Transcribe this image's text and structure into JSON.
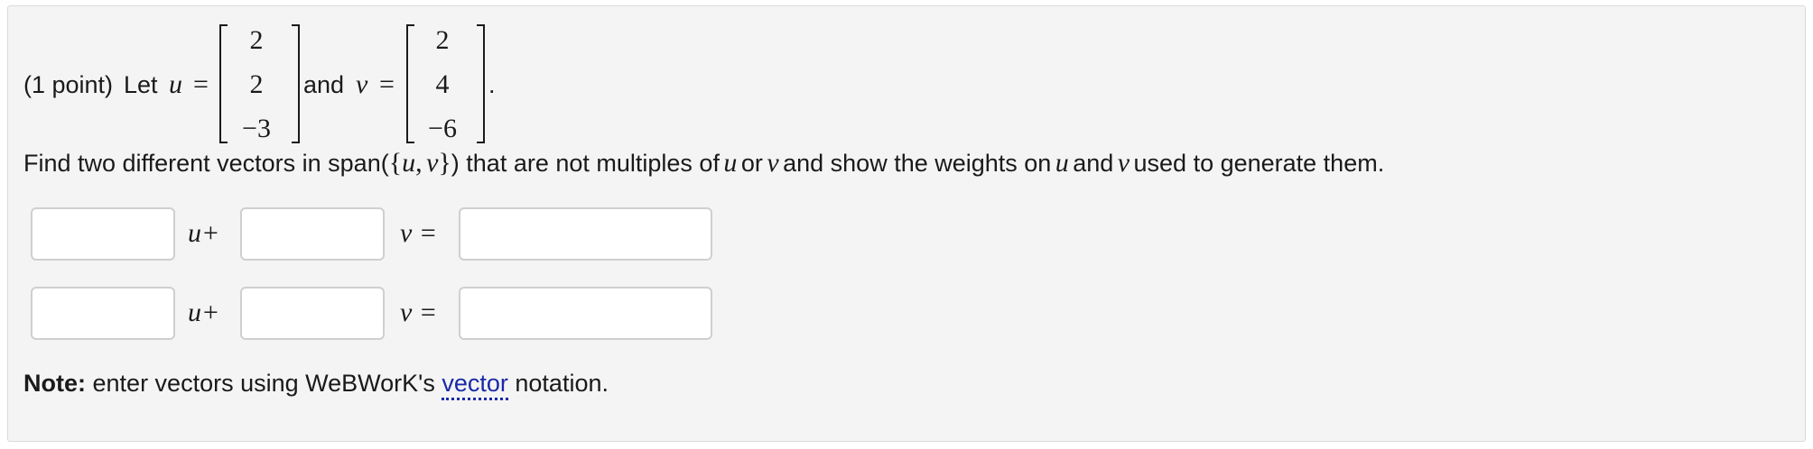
{
  "problem": {
    "points": "(1 point)",
    "let": "Let",
    "u_var": "u",
    "eq": "=",
    "and": "and",
    "v_var": "v",
    "period": ".",
    "u_vector": [
      "2",
      "2",
      "−3"
    ],
    "v_vector": [
      "2",
      "4",
      "−6"
    ],
    "find_1": "Find two different vectors in span(",
    "set_open": "{",
    "set_u": "u",
    "comma": ",",
    "set_v": "v",
    "set_close": "}",
    "find_2": ") that are not multiples of",
    "or": "or",
    "find_3": "and show the weights on",
    "and2": "and",
    "find_4": "used to generate them."
  },
  "rows": [
    {
      "coef_u_value": "",
      "plus_label": "u+",
      "coef_v_value": "",
      "v_label": "v =",
      "result_value": ""
    },
    {
      "coef_u_value": "",
      "plus_label": "u+",
      "coef_v_value": "",
      "v_label": "v =",
      "result_value": ""
    }
  ],
  "note": {
    "label": "Note:",
    "text": "enter vectors using WeBWorK's",
    "link": "vector",
    "text_end": "notation."
  }
}
